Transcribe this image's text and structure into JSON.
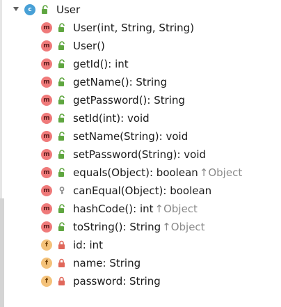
{
  "tree": {
    "class_name": "User",
    "class_badge": "c",
    "members": [
      {
        "label": "User(int, String, String)",
        "badge": "m",
        "vis": "public"
      },
      {
        "label": "User()",
        "badge": "m",
        "vis": "public"
      },
      {
        "label": "getId(): int",
        "badge": "m",
        "vis": "public"
      },
      {
        "label": "getName(): String",
        "badge": "m",
        "vis": "public"
      },
      {
        "label": "getPassword(): String",
        "badge": "m",
        "vis": "public"
      },
      {
        "label": "setId(int): void",
        "badge": "m",
        "vis": "public"
      },
      {
        "label": "setName(String): void",
        "badge": "m",
        "vis": "public"
      },
      {
        "label": "setPassword(String): void",
        "badge": "m",
        "vis": "public"
      },
      {
        "label": "equals(Object): boolean",
        "inherit": "↑Object",
        "badge": "m",
        "vis": "public"
      },
      {
        "label": "canEqual(Object): boolean",
        "badge": "m",
        "vis": "protected"
      },
      {
        "label": "hashCode(): int",
        "inherit": "↑Object",
        "badge": "m",
        "vis": "public"
      },
      {
        "label": "toString(): String",
        "inherit": "↑Object",
        "badge": "m",
        "vis": "public"
      },
      {
        "label": "id: int",
        "badge": "f",
        "vis": "private"
      },
      {
        "label": "name: String",
        "badge": "f",
        "vis": "private"
      },
      {
        "label": "password: String",
        "badge": "f",
        "vis": "private"
      }
    ]
  },
  "colors": {
    "class_badge": "#48a0d6",
    "method_badge": "#ef7a7a",
    "field_badge": "#f4c27a",
    "public_lock": "#5fa640",
    "private_lock": "#e0675a",
    "protected_key": "#8a8a8a",
    "inherit_text": "#8a8a8a"
  }
}
